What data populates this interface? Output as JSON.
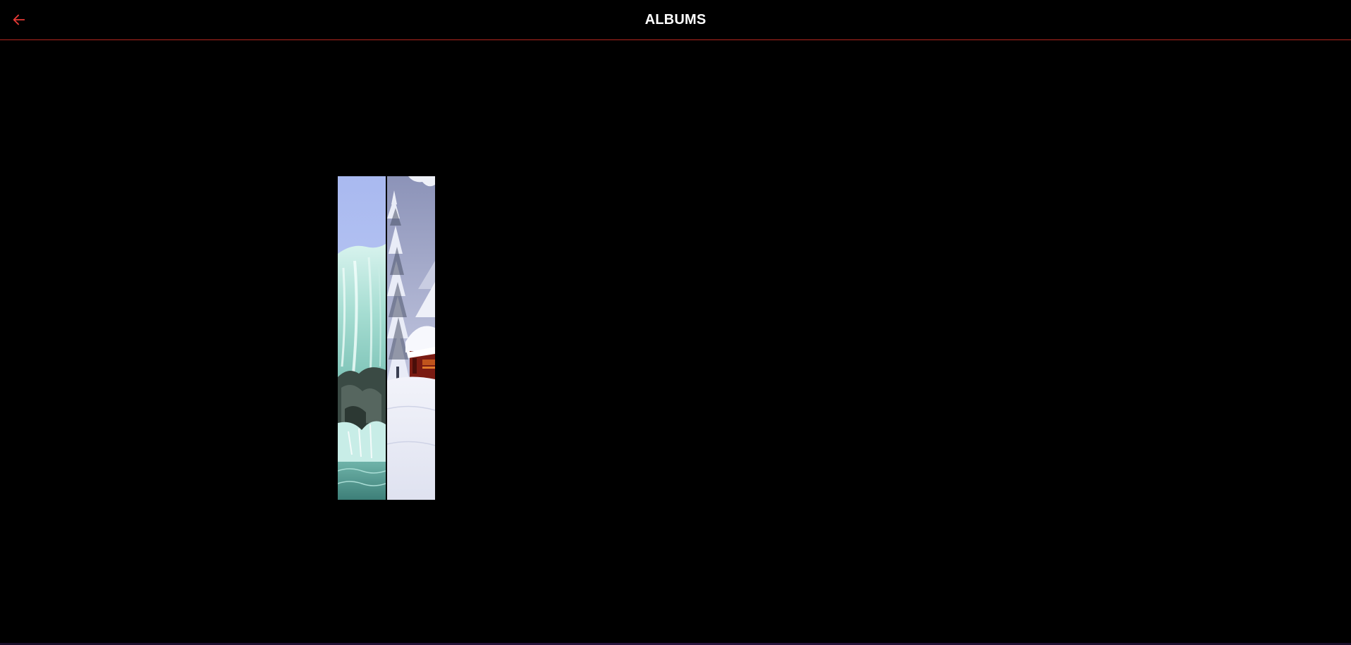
{
  "header": {
    "title": "ALBUMS",
    "back_icon": "arrow-left-icon",
    "accent_color": "#e53935",
    "divider_color": "#b3261e"
  },
  "albums": [
    {
      "thumbnail": "waterfall-landscape-image"
    },
    {
      "thumbnail": "snowy-cabin-landscape-image"
    }
  ]
}
